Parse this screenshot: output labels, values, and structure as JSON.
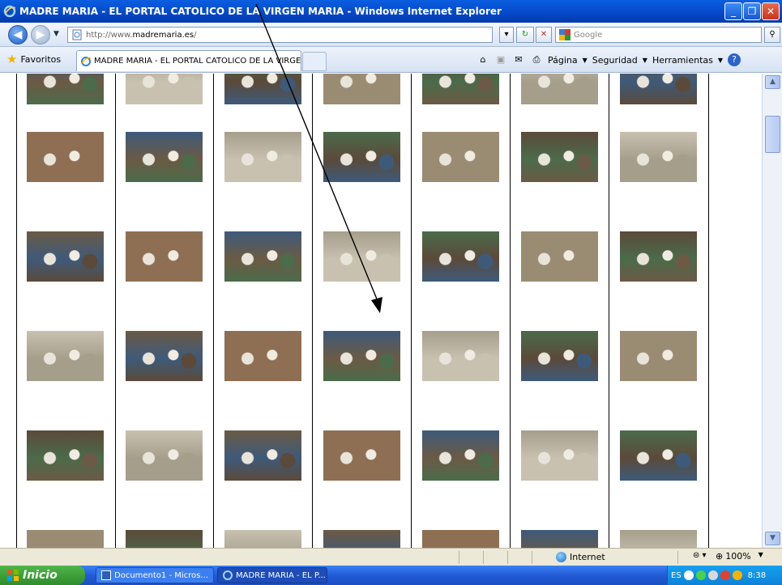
{
  "window": {
    "title": "MADRE MARIA - EL PORTAL CATOLICO DE LA VIRGEN MARIA - Windows Internet Explorer",
    "minimize": "_",
    "maximize": "❐",
    "close": "✕"
  },
  "nav": {
    "back": "◀",
    "forward": "▶",
    "url_prefix": "http://www.",
    "url_domain": "madremaria.es",
    "url_suffix": "/",
    "search_placeholder": "Google",
    "refresh": "↻",
    "stop": "✕",
    "search_go": "⚲"
  },
  "tabs": {
    "favorites": "Favoritos",
    "active_tab": "MADRE MARIA - EL PORTAL CATOLICO DE LA VIRGE...",
    "commands": [
      "Página",
      "Seguridad",
      "Herramientas"
    ]
  },
  "status": {
    "zone": "Internet",
    "zoom": "100%"
  },
  "taskbar": {
    "start": "Inicio",
    "tasks": [
      "Documento1 - Micros...",
      "MADRE MARIA - EL P..."
    ],
    "language": "ES",
    "clock": "8:38"
  },
  "gallery": {
    "columns": 7,
    "rows_visible": 6,
    "palette": [
      "#6b5a45",
      "#9a8c73",
      "#3e5a7a",
      "#c9c1b0",
      "#4b6b4a",
      "#8e6f53",
      "#5b4a3a",
      "#a59e8b"
    ]
  },
  "colors": {
    "title_blue": "#0447c9",
    "start_green": "#2f8c2b",
    "tray_blue": "#0c82d8",
    "statusbar": "#ece9d8"
  }
}
